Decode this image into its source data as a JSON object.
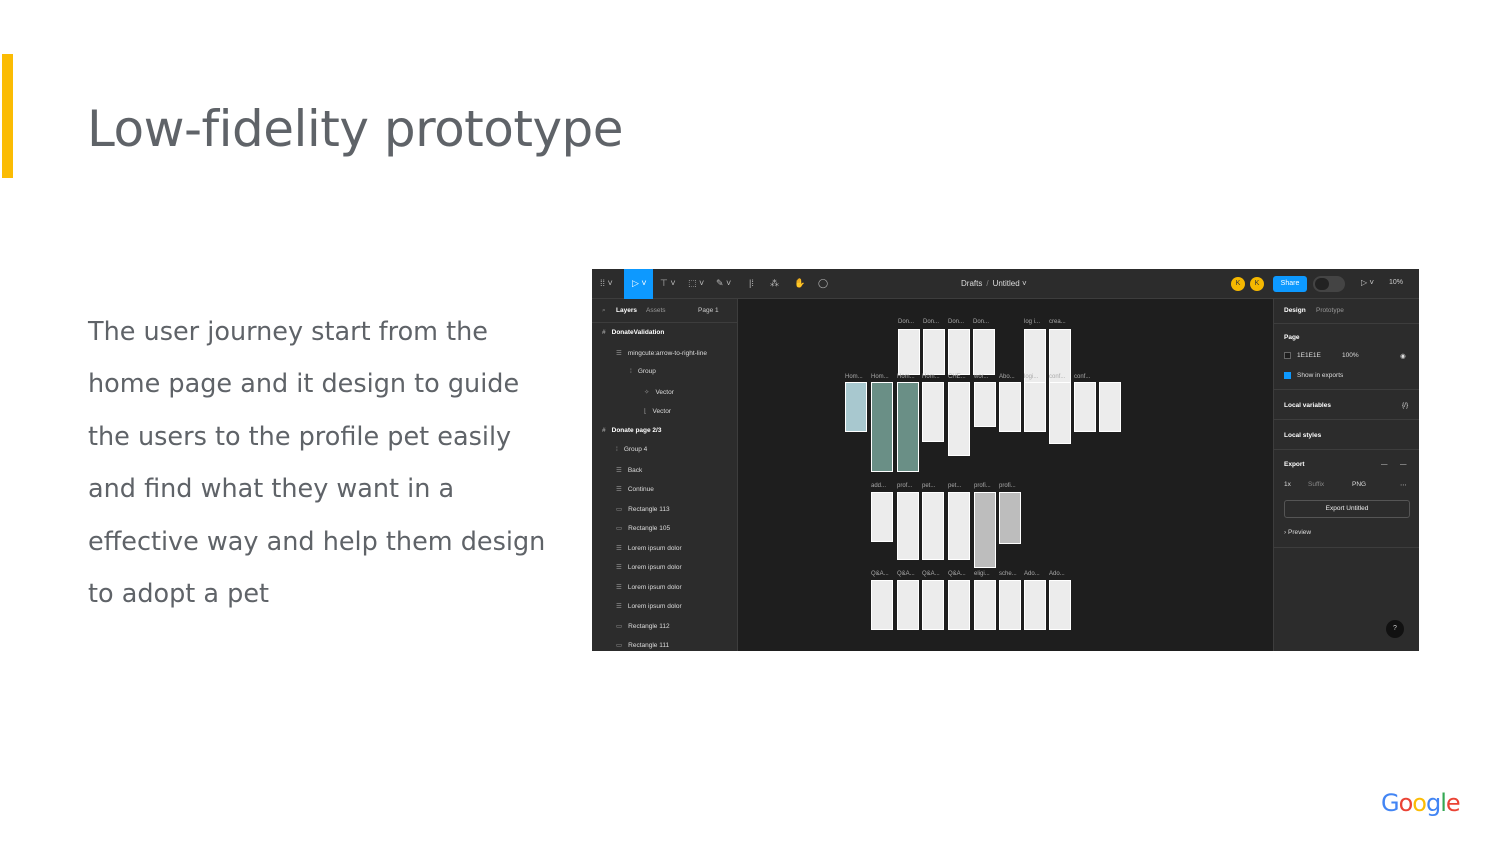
{
  "slide": {
    "title": "Low-fidelity prototype",
    "body": "The user journey start from the home page and it design to guide the users to the profile pet easily and find what they want in a effective way and help them design to adopt a pet",
    "accent_color": "#fbbc04",
    "text_color": "#5f6368"
  },
  "figma": {
    "breadcrumb": {
      "folder": "Drafts",
      "file": "Untitled"
    },
    "avatars": [
      "K",
      "K"
    ],
    "share_label": "Share",
    "zoom": "10%",
    "left_panel": {
      "tabs": {
        "layers": "Layers",
        "assets": "Assets",
        "page": "Page 1"
      },
      "layers": [
        {
          "label": "DonateValidation",
          "icon": "#",
          "bold": true
        },
        {
          "label": "mingcute:arrow-to-right-line",
          "icon": "☰"
        },
        {
          "label": "Group",
          "icon": "⁞"
        },
        {
          "label": "Vector",
          "icon": "✧"
        },
        {
          "label": "Vector",
          "icon": "⌊"
        },
        {
          "label": "Donate page 2/3",
          "icon": "#",
          "bold": true
        },
        {
          "label": "Group 4",
          "icon": "⁞"
        },
        {
          "label": "Back",
          "icon": "☰"
        },
        {
          "label": "Continue",
          "icon": "☰"
        },
        {
          "label": "Rectangle 113",
          "icon": "▭"
        },
        {
          "label": "Rectangle 105",
          "icon": "▭"
        },
        {
          "label": "Lorem ipsum dolor",
          "icon": "☰"
        },
        {
          "label": "Lorem ipsum dolor",
          "icon": "☰"
        },
        {
          "label": "Lorem ipsum dolor",
          "icon": "☰"
        },
        {
          "label": "Lorem ipsum dolor",
          "icon": "☰"
        },
        {
          "label": "Rectangle 112",
          "icon": "▭"
        },
        {
          "label": "Rectangle 111",
          "icon": "▭"
        }
      ]
    },
    "right_panel": {
      "tabs": {
        "design": "Design",
        "prototype": "Prototype"
      },
      "page_label": "Page",
      "page_color": "1E1E1E",
      "page_opacity": "100%",
      "show_exports": "Show in exports",
      "local_variables": "Local variables",
      "local_styles": "Local styles",
      "export_label": "Export",
      "export_scale": "1x",
      "export_suffix": "Suffix",
      "export_format": "PNG",
      "export_button": "Export Untitled",
      "preview": "Preview"
    },
    "canvas_labels": [
      {
        "text": "Don...",
        "r": 0
      },
      {
        "text": "Don...",
        "r": 0
      },
      {
        "text": "Don...",
        "r": 0
      },
      {
        "text": "Don...",
        "r": 0
      },
      {
        "text": "log i...",
        "r": 0
      },
      {
        "text": "crea...",
        "r": 0
      },
      {
        "text": "Hom...",
        "r": 1
      },
      {
        "text": "Hom...",
        "r": 1
      },
      {
        "text": "Hom...",
        "r": 1
      },
      {
        "text": "Hom...",
        "r": 1
      },
      {
        "text": "CHE...",
        "r": 1
      },
      {
        "text": "wor...",
        "r": 1
      },
      {
        "text": "Abo...",
        "r": 1
      },
      {
        "text": "logi...",
        "r": 1
      },
      {
        "text": "conf...",
        "r": 1
      },
      {
        "text": "conf...",
        "r": 1
      },
      {
        "text": "add...",
        "r": 2
      },
      {
        "text": "prof...",
        "r": 2
      },
      {
        "text": "pet...",
        "r": 2
      },
      {
        "text": "pet...",
        "r": 2
      },
      {
        "text": "profi...",
        "r": 2
      },
      {
        "text": "profi...",
        "r": 2
      },
      {
        "text": "Q&A...",
        "r": 3
      },
      {
        "text": "Q&A...",
        "r": 3
      },
      {
        "text": "Q&A...",
        "r": 3
      },
      {
        "text": "Q&A...",
        "r": 3
      },
      {
        "text": "eligi...",
        "r": 3
      },
      {
        "text": "sche...",
        "r": 3
      },
      {
        "text": "Ado...",
        "r": 3
      },
      {
        "text": "Ado...",
        "r": 3
      }
    ],
    "google_logo": "Google"
  }
}
